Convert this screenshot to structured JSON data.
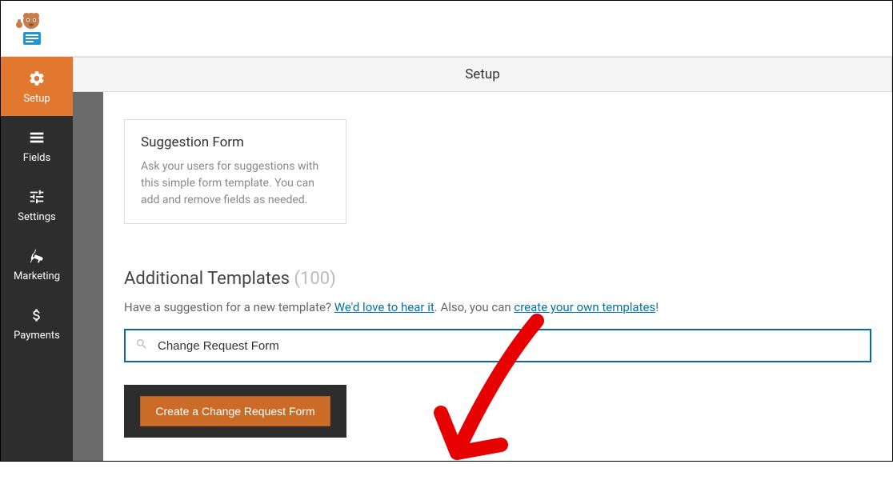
{
  "header": {
    "tab_title": "Setup"
  },
  "sidebar": {
    "items": [
      {
        "label": "Setup"
      },
      {
        "label": "Fields"
      },
      {
        "label": "Settings"
      },
      {
        "label": "Marketing"
      },
      {
        "label": "Payments"
      }
    ]
  },
  "template_card": {
    "title": "Suggestion Form",
    "description": "Ask your users for suggestions with this simple form template. You can add and remove fields as needed."
  },
  "additional": {
    "label": "Additional Templates",
    "count": "(100)",
    "suggestion_prefix": "Have a suggestion for a new template? ",
    "link_hear": "We'd love to hear it",
    "middle": ". Also, you can ",
    "link_create": "create your own templates",
    "suffix": "!"
  },
  "search": {
    "value": "Change Request Form"
  },
  "result": {
    "button_label": "Create a Change Request Form"
  }
}
